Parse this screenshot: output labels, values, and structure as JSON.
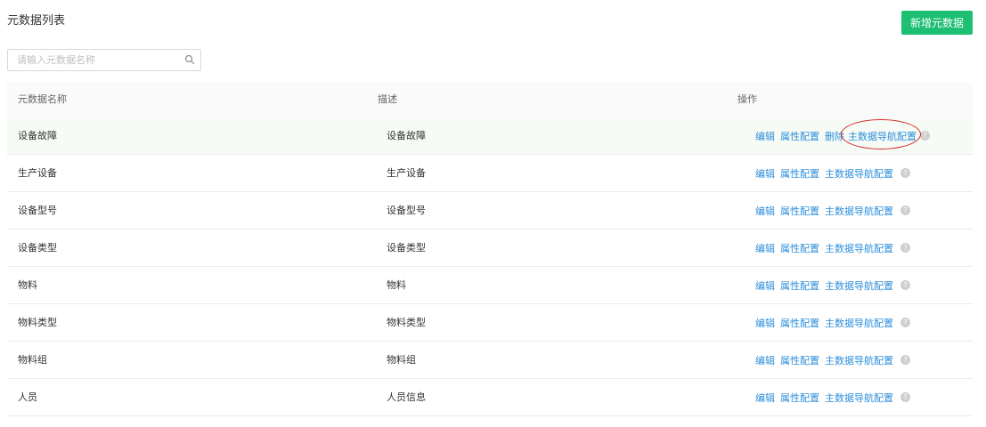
{
  "header": {
    "title": "元数据列表",
    "add_button": "新增元数据"
  },
  "search": {
    "placeholder": "请输入元数据名称",
    "icon": "search-icon"
  },
  "table": {
    "columns": [
      "元数据名称",
      "描述",
      "操作"
    ],
    "rows": [
      {
        "name": "设备故障",
        "desc": "设备故障"
      },
      {
        "name": "生产设备",
        "desc": "生产设备"
      },
      {
        "name": "设备型号",
        "desc": "设备型号"
      },
      {
        "name": "设备类型",
        "desc": "设备类型"
      },
      {
        "name": "物料",
        "desc": "物料"
      },
      {
        "name": "物料类型",
        "desc": "物料类型"
      },
      {
        "name": "物料组",
        "desc": "物料组"
      },
      {
        "name": "人员",
        "desc": "人员信息"
      }
    ],
    "actions": {
      "edit": "编辑",
      "attr_config": "属性配置",
      "delete": "删除",
      "nav_config": "主数据导航配置",
      "help_icon": "help-circle-icon"
    }
  },
  "colors": {
    "primary_green": "#1dbf73",
    "link_blue": "#2f8fdb",
    "annotation_red": "#d42a2a"
  }
}
